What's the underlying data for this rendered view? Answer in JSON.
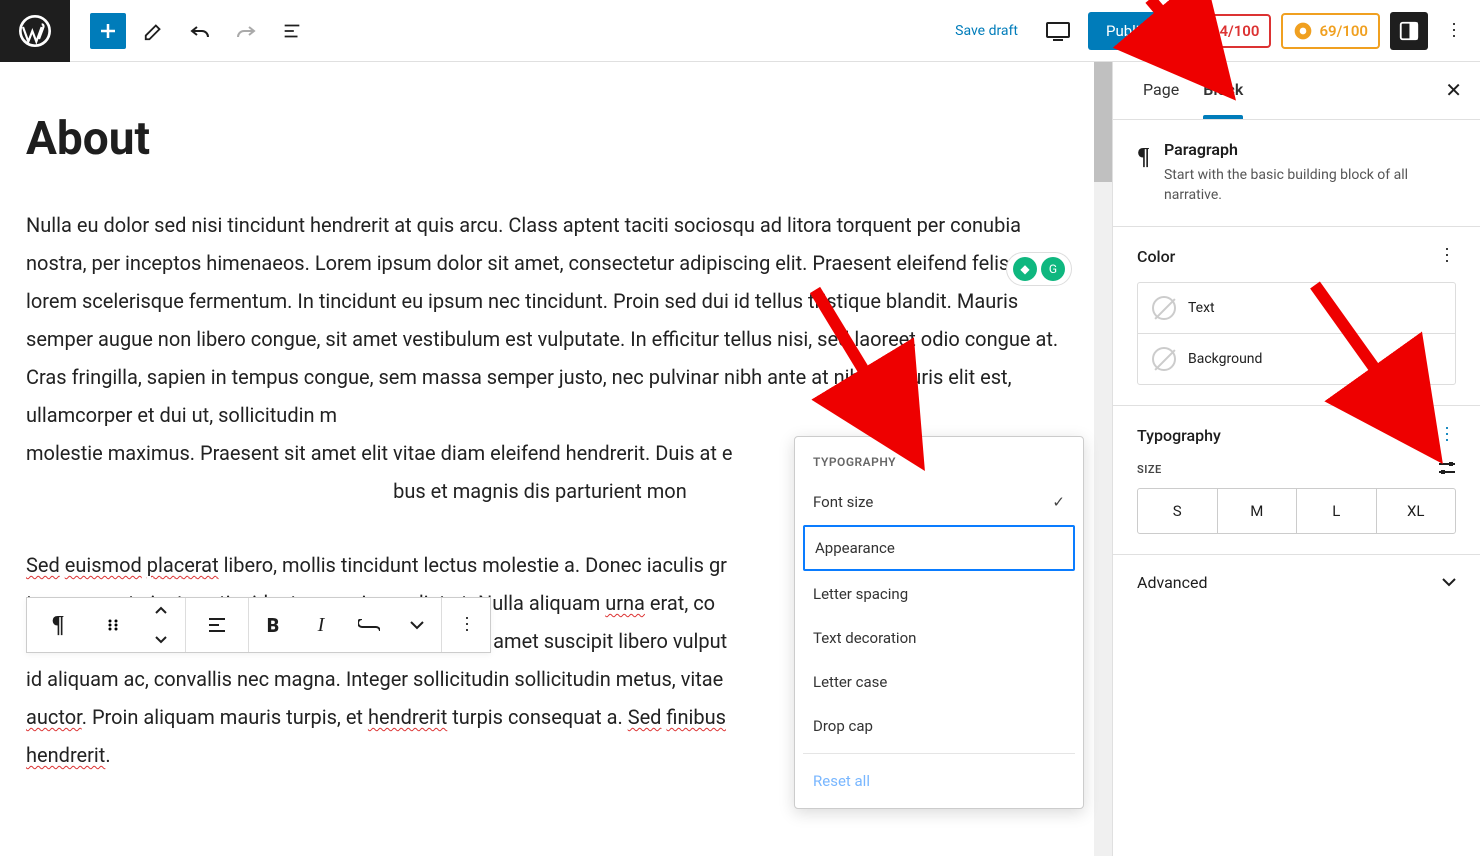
{
  "topbar": {
    "save_draft": "Save draft",
    "publish": "Publish",
    "score_seo": "4/100",
    "score_read": "69/100"
  },
  "editor": {
    "title": "About",
    "para1_a": "Nulla eu dolor sed nisi tincidunt hendrerit at quis arcu. Class aptent taciti sociosqu ad litora torquent per conubia nostra, per inceptos himenaeos. Lorem ipsum dolor sit amet, consectetur adipiscing elit. Praesent eleifend felis et lorem scelerisque fermentum. In tincidunt eu ipsum nec tincidunt. Proin sed dui id tellus tristique blandit. Mauris semper augue non libero congue, sit amet vestibulum est vulputate. In efficitur tellus nisi, sed laoreet odio congue at. Cras fringilla, sapien in tempus congue, sem massa semper justo, nec pulvinar nibh ante at nibh. Mauris elit est, ullamcorper et dui ut, sollicitudin m",
    "para1_b": "molestie maximus. Praesent sit amet elit vitae diam eleifend hendrerit. Duis at e",
    "para1_c": "bus et magnis dis parturient mon",
    "para2_pre": "Sed",
    "para2_w1": "euismod",
    "para2_w2": "placerat",
    "para2_a": " libero, mollis tincidunt lectus molestie a. Donec iaculis gr",
    "para2_b": "tempus porta justo, a tincidunt augue imperdiet et. Nulla aliquam ",
    "para2_w3": "urna",
    "para2_c": " erat, co",
    "para2_d": "venenatis at. Etiam lobortis arcu at enim pulvinar, sit amet suscipit libero vulput",
    "para2_e": "id aliquam ac, convallis nec magna. Integer sollicitudin sollicitudin metus, vitae ",
    "para2_w4": "auctor",
    "para2_f": ". Proin aliquam mauris turpis, et ",
    "para2_w5": "hendrerit",
    "para2_g": " turpis consequat a. ",
    "para2_w6": "Sed",
    "para2_w7": "finibus",
    "para2_w8": "hendrerit",
    "para2_end": "."
  },
  "typo_popup": {
    "header": "TYPOGRAPHY",
    "font_size": "Font size",
    "appearance": "Appearance",
    "letter_spacing": "Letter spacing",
    "text_decoration": "Text decoration",
    "letter_case": "Letter case",
    "drop_cap": "Drop cap",
    "reset_all": "Reset all"
  },
  "sidebar": {
    "tab_page": "Page",
    "tab_block": "Block",
    "block_name": "Paragraph",
    "block_desc": "Start with the basic building block of all narrative.",
    "color_hdr": "Color",
    "color_text": "Text",
    "color_bg": "Background",
    "typo_hdr": "Typography",
    "size_label": "SIZE",
    "sizes": {
      "s": "S",
      "m": "M",
      "l": "L",
      "xl": "XL"
    },
    "advanced": "Advanced"
  }
}
